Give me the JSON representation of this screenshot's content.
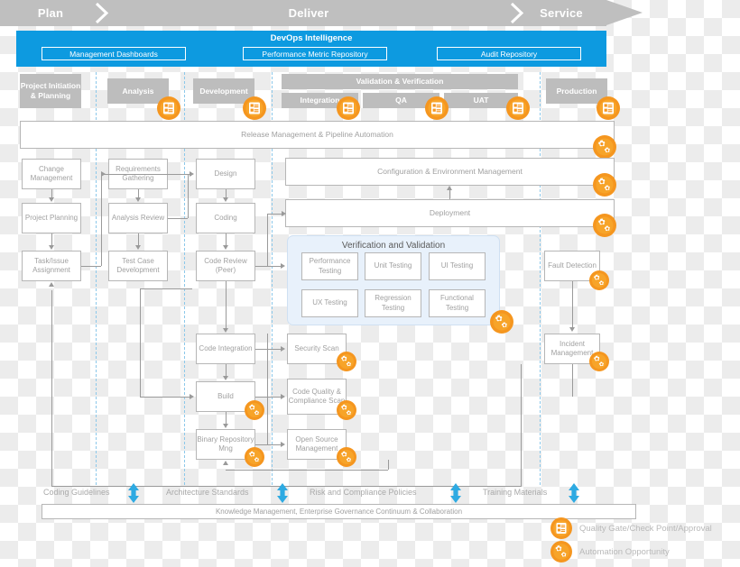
{
  "phases": [
    {
      "label": "Plan"
    },
    {
      "label": "Deliver"
    },
    {
      "label": "Service"
    }
  ],
  "devops": {
    "title": "DevOps Intelligence",
    "buttons": [
      {
        "label": "Management Dashboards"
      },
      {
        "label": "Performance Metric Repository"
      },
      {
        "label": "Audit Repository"
      }
    ]
  },
  "stages": {
    "project_initiation": "Project Initiation & Planning",
    "analysis": "Analysis",
    "development": "Development",
    "validation_verification": "Validation & Verification",
    "integration": "Integration",
    "qa": "QA",
    "uat": "UAT",
    "production": "Production"
  },
  "bars": {
    "release_mgmt": "Release Management & Pipeline Automation",
    "config_env": "Configuration & Environment Management",
    "deployment": "Deployment"
  },
  "col_plan": [
    {
      "label": "Change Management"
    },
    {
      "label": "Project Planning"
    },
    {
      "label": "Task/Issue Assignment"
    }
  ],
  "col_analysis": [
    {
      "label": "Requirements Gathering"
    },
    {
      "label": "Analysis Review"
    },
    {
      "label": "Test Case Development"
    }
  ],
  "col_dev": [
    {
      "label": "Design"
    },
    {
      "label": "Coding"
    },
    {
      "label": "Code Review (Peer)"
    },
    {
      "label": "Code Integration"
    },
    {
      "label": "Build"
    },
    {
      "label": "Binary Repository Mng"
    }
  ],
  "col_scan": [
    {
      "label": "Security Scan"
    },
    {
      "label": "Code Quality & Compliance Scan"
    },
    {
      "label": "Open Source Management"
    }
  ],
  "vv": {
    "title": "Verification and Validation",
    "items": [
      {
        "label": "Performance Testing"
      },
      {
        "label": "Unit Testing"
      },
      {
        "label": "UI Testing"
      },
      {
        "label": "UX Testing"
      },
      {
        "label": "Regression Testing"
      },
      {
        "label": "Functional Testing"
      }
    ]
  },
  "col_service": [
    {
      "label": "Fault Detection"
    },
    {
      "label": "Incident Management"
    }
  ],
  "foundation": {
    "items": [
      {
        "label": "Coding Guidelines"
      },
      {
        "label": "Architecture Standards"
      },
      {
        "label": "Risk and Compliance Policies"
      },
      {
        "label": "Training Materials"
      }
    ],
    "knowledge_bar": "Knowledge Management, Enterprise Governance Continuum & Collaboration"
  },
  "legend": [
    {
      "icon": "quality-gate-icon",
      "label": "Quality Gate/Check Point/Approval"
    },
    {
      "icon": "automation-gears-icon",
      "label": "Automation Opportunity"
    }
  ],
  "colors": {
    "accent_blue": "#0d9ae0",
    "phase_gray": "#bfbfbf",
    "orange": "#f59522",
    "box_border": "#b6b6b6",
    "text_gray": "#a0a0a0"
  }
}
